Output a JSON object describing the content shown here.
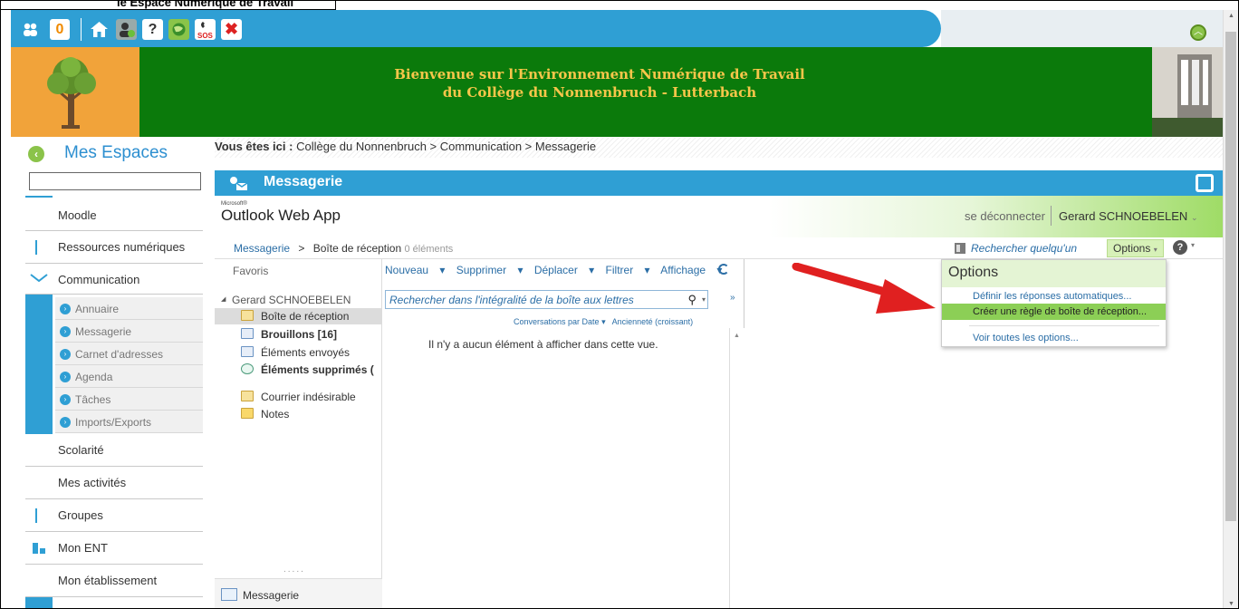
{
  "top_cut_text": "le Espace Numérique de Travail",
  "toolbar": {
    "counter": "0",
    "icons": [
      "users-icon",
      "home-icon",
      "account-icon",
      "help-icon",
      "globe-icon",
      "sos-icon",
      "close-icon"
    ]
  },
  "banner": {
    "line1": "Bienvenue sur l'Environnement Numérique de Travail",
    "line2": "du Collège du Nonnenbruch - Lutterbach"
  },
  "sidebar": {
    "title": "Mes Espaces",
    "items": [
      {
        "label": "Moodle",
        "icon": "moodle-icon"
      },
      {
        "label": "Ressources numériques",
        "icon": "resources-icon"
      },
      {
        "label": "Communication",
        "icon": "mail-icon"
      },
      {
        "label": "Scolarité",
        "icon": "clipboard-icon"
      },
      {
        "label": "Mes activités",
        "icon": "clipboard-icon"
      },
      {
        "label": "Groupes",
        "icon": "groups-icon"
      },
      {
        "label": "Mon ENT",
        "icon": "dashboard-icon"
      },
      {
        "label": "Mon établissement",
        "icon": "home-icon"
      }
    ],
    "sub_items": [
      "Annuaire",
      "Messagerie",
      "Carnet d'adresses",
      "Agenda",
      "Tâches",
      "Imports/Exports"
    ]
  },
  "breadcrumb": {
    "prefix": "Vous êtes ici :",
    "path": "Collège du Nonnenbruch > Communication > Messagerie"
  },
  "page_title": "Messagerie",
  "owa": {
    "logo_small": "Microsoft®",
    "logo": "Outlook Web App",
    "logout": "se déconnecter",
    "user": "Gerard SCHNOEBELEN",
    "crumb_root": "Messagerie",
    "crumb_sep": ">",
    "crumb_current": "Boîte de réception",
    "crumb_count": "0 éléments",
    "search_people": "Rechercher quelqu'un",
    "options_btn": "Options",
    "favorites": "Favoris",
    "mailbox_owner": "Gerard SCHNOEBELEN",
    "folders": [
      "Boîte de réception",
      "Brouillons [16]",
      "Éléments envoyés",
      "Éléments supprimés (",
      "Courrier indésirable",
      "Notes"
    ],
    "commands": [
      "Nouveau",
      "Supprimer",
      "Déplacer",
      "Filtrer",
      "Affichage"
    ],
    "search_placeholder": "Rechercher dans l'intégralité de la boîte aux lettres",
    "sort_text": "Conversations par Date",
    "sort_order": "Ancienneté (croissant)",
    "empty_text": "Il n'y a aucun élément à afficher dans cette vue.",
    "bottom_tab": "Messagerie",
    "dots": "....."
  },
  "options_menu": {
    "title": "Options",
    "items": [
      "Définir les réponses automatiques...",
      "Créer une règle de boîte de réception...",
      "Voir toutes les options..."
    ]
  },
  "colors": {
    "accent_blue": "#2f9fd4",
    "banner_green": "#0b7a0b",
    "banner_text": "#f7c64a",
    "highlight_green": "#8ccf56",
    "arrow_red": "#e02020"
  }
}
